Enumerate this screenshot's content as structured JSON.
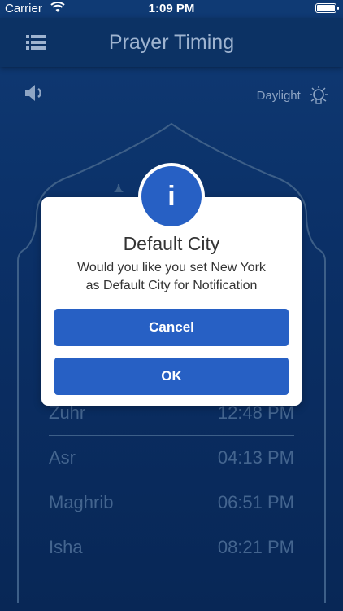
{
  "status_bar": {
    "carrier": "Carrier",
    "time": "1:09 PM"
  },
  "header": {
    "title": "Prayer Timing",
    "menu_icon": "hamburger-menu-icon"
  },
  "controls": {
    "sound_icon": "speaker-icon",
    "daylight_label": "Daylight",
    "daylight_icon": "lightbulb-icon"
  },
  "prayer_times": [
    {
      "name": "Zuhr",
      "time": "12:48 PM"
    },
    {
      "name": "Asr",
      "time": "04:13 PM"
    },
    {
      "name": "Maghrib",
      "time": "06:51 PM"
    },
    {
      "name": "Isha",
      "time": "08:21 PM"
    }
  ],
  "dialog": {
    "icon": "i",
    "title": "Default City",
    "message_line1": "Would you like you set New York",
    "message_line2": "as Default City for Notification",
    "cancel_label": "Cancel",
    "ok_label": "OK"
  },
  "colors": {
    "primary": "#2760c4",
    "background": "#0c3264",
    "muted_text": "#44658f"
  }
}
